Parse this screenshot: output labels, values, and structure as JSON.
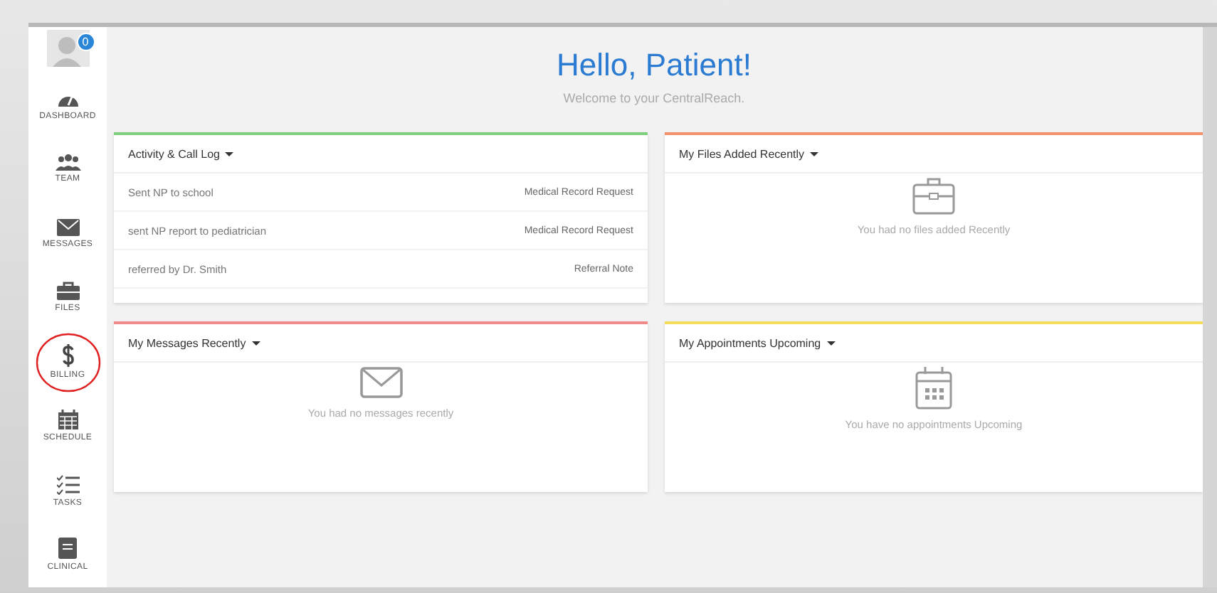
{
  "sidebar": {
    "avatar": {
      "badge": "0"
    },
    "items": [
      {
        "kind": "dashboard",
        "label": "DASHBOARD",
        "highlighted": false
      },
      {
        "kind": "team",
        "label": "TEAM",
        "highlighted": false
      },
      {
        "kind": "messages",
        "label": "MESSAGES",
        "highlighted": false
      },
      {
        "kind": "files",
        "label": "FILES",
        "highlighted": false
      },
      {
        "kind": "billing",
        "label": "BILLING",
        "highlighted": true
      },
      {
        "kind": "schedule",
        "label": "SCHEDULE",
        "highlighted": false
      },
      {
        "kind": "tasks",
        "label": "TASKS",
        "highlighted": false
      },
      {
        "kind": "clinical",
        "label": "CLINICAL",
        "highlighted": false
      }
    ]
  },
  "greeting": {
    "title": "Hello, Patient!",
    "subtitle": "Welcome to your CentralReach."
  },
  "cards": [
    {
      "kind": "list",
      "title": "Activity & Call Log",
      "color": "#7fcf7f",
      "rows": [
        {
          "text": "Sent NP to school",
          "tag": "Medical Record Request"
        },
        {
          "text": "sent NP report to pediatrician",
          "tag": "Medical Record Request"
        },
        {
          "text": "referred by Dr. Smith",
          "tag": "Referral Note"
        }
      ]
    },
    {
      "kind": "files",
      "title": "My Files Added Recently",
      "color": "#f5916a",
      "empty_text": "You had no files added Recently"
    },
    {
      "kind": "messages",
      "title": "My Messages Recently",
      "color": "#f08a8a",
      "empty_text": "You had no messages recently"
    },
    {
      "kind": "appointments",
      "title": "My Appointments Upcoming",
      "color": "#f5dc5a",
      "empty_text": "You have no appointments Upcoming"
    }
  ]
}
